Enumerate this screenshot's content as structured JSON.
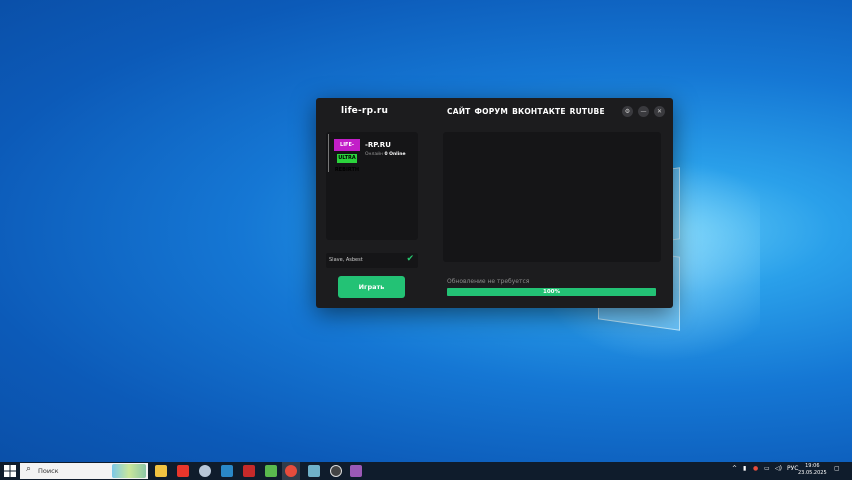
{
  "launcher": {
    "brand": "life-rp.ru",
    "nav": [
      "САЙТ",
      "ФОРУМ",
      "ВКОНТАКТЕ",
      "RUTUBE"
    ],
    "server": {
      "name": "-RP.RU",
      "online_label": "Онлайн",
      "online_count": "0 Online",
      "logo_top": "LIFE-RP.RU",
      "logo_bottom": "ULTRA REBIRTH"
    },
    "status_text": "Slave, Asbest",
    "play_label": "Играть",
    "update_label": "Обновление не требуется",
    "progress_text": "100%",
    "progress_value": 100,
    "accent_color": "#23c275"
  },
  "taskbar": {
    "search_placeholder": "Поиск",
    "language": "РУС",
    "time": "19:06",
    "date": "23.05.2025"
  }
}
